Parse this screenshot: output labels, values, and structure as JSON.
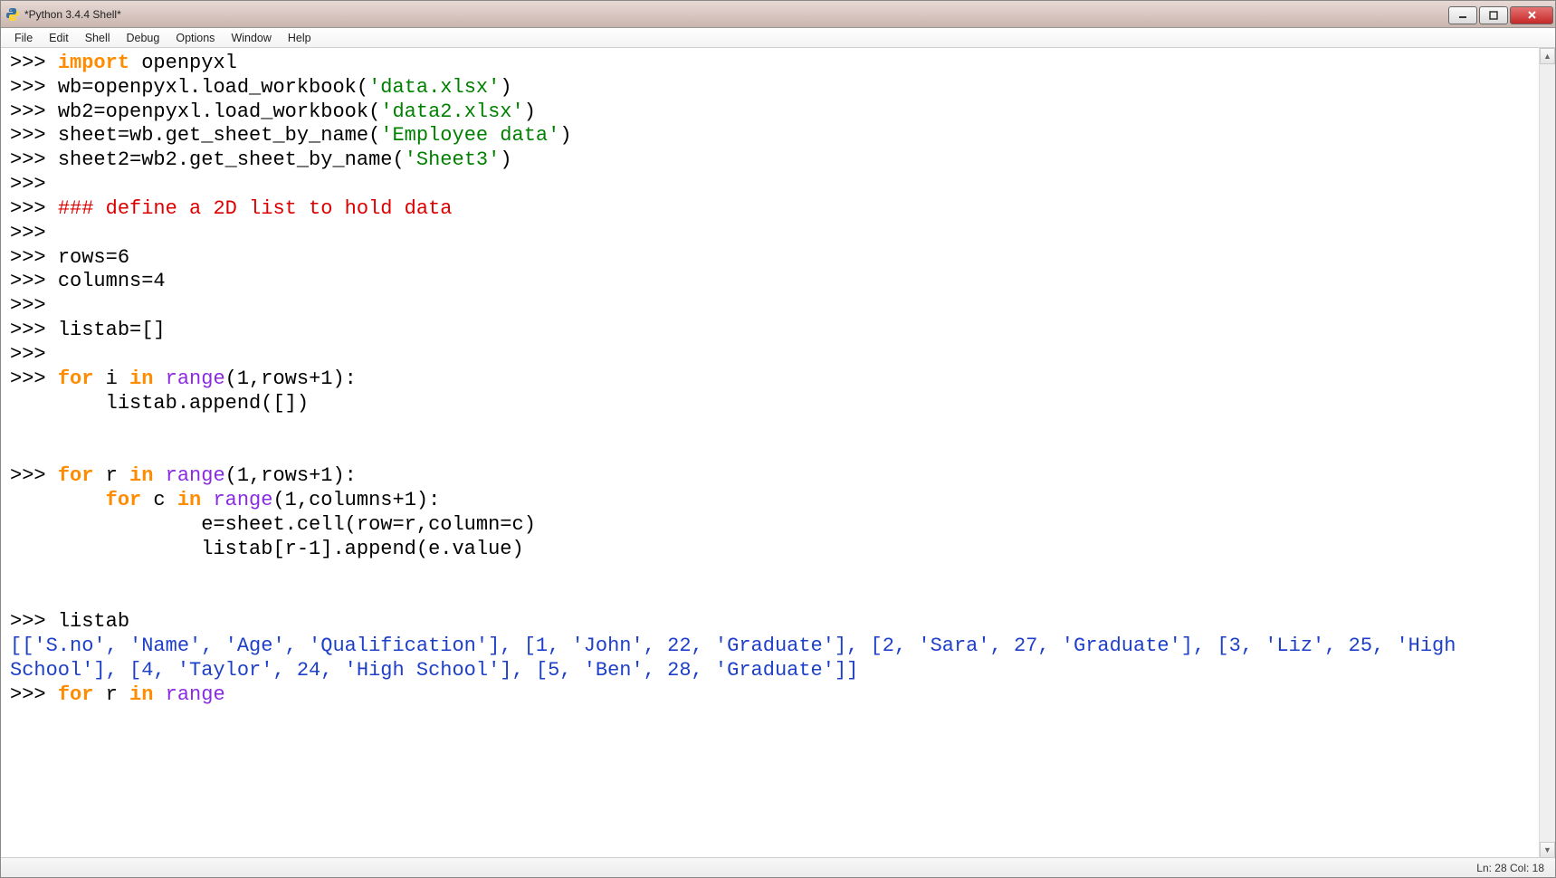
{
  "titlebar": {
    "title": "*Python 3.4.4 Shell*"
  },
  "menubar": {
    "items": [
      "File",
      "Edit",
      "Shell",
      "Debug",
      "Options",
      "Window",
      "Help"
    ]
  },
  "code": {
    "l1": {
      "prompt": ">>> ",
      "kw": "import",
      "rest": " openpyxl"
    },
    "l2": {
      "prompt": ">>> ",
      "a": "wb=openpyxl.load_workbook(",
      "s": "'data.xlsx'",
      "b": ")"
    },
    "l3": {
      "prompt": ">>> ",
      "a": "wb2=openpyxl.load_workbook(",
      "s": "'data2.xlsx'",
      "b": ")"
    },
    "l4": {
      "prompt": ">>> ",
      "a": "sheet=wb.get_sheet_by_name(",
      "s": "'Employee data'",
      "b": ")"
    },
    "l5": {
      "prompt": ">>> ",
      "a": "sheet2=wb2.get_sheet_by_name(",
      "s": "'Sheet3'",
      "b": ")"
    },
    "l6": {
      "prompt": ">>> "
    },
    "l7": {
      "prompt": ">>> ",
      "c": "### define a 2D list to hold data"
    },
    "l8": {
      "prompt": ">>> "
    },
    "l9": {
      "prompt": ">>> ",
      "a": "rows=6"
    },
    "l10": {
      "prompt": ">>> ",
      "a": "columns=4"
    },
    "l11": {
      "prompt": ">>> "
    },
    "l12": {
      "prompt": ">>> ",
      "a": "listab=[]"
    },
    "l13": {
      "prompt": ">>> "
    },
    "l14": {
      "prompt": ">>> ",
      "kw1": "for",
      "a1": " i ",
      "kw2": "in",
      "a2": " ",
      "fn": "range",
      "a3": "(1,rows+1):"
    },
    "l15": {
      "a": "        listab.append([])"
    },
    "l16": {
      "a": ""
    },
    "l17": {
      "a": "        "
    },
    "l18": {
      "prompt": ">>> ",
      "kw1": "for",
      "a1": " r ",
      "kw2": "in",
      "a2": " ",
      "fn": "range",
      "a3": "(1,rows+1):"
    },
    "l19": {
      "pad": "        ",
      "kw1": "for",
      "a1": " c ",
      "kw2": "in",
      "a2": " ",
      "fn": "range",
      "a3": "(1,columns+1):"
    },
    "l20": {
      "a": "                e=sheet.cell(row=r,column=c)"
    },
    "l21": {
      "a": "                listab[r-1].append(e.value)"
    },
    "l22": {
      "a": ""
    },
    "l23": {
      "a": "                "
    },
    "l24": {
      "prompt": ">>> ",
      "a": "listab"
    },
    "l25": {
      "out": "[['S.no', 'Name', 'Age', 'Qualification'], [1, 'John', 22, 'Graduate'], [2, 'Sara', 27, 'Graduate'], [3, 'Liz', 25, 'High School'], [4, 'Taylor', 24, 'High School'], [5, 'Ben', 28, 'Graduate']]"
    },
    "l26": {
      "prompt": ">>> ",
      "kw1": "for",
      "a1": " r ",
      "kw2": "in",
      "a2": " ",
      "fn": "range"
    }
  },
  "statusbar": {
    "text": "Ln: 28  Col: 18"
  }
}
